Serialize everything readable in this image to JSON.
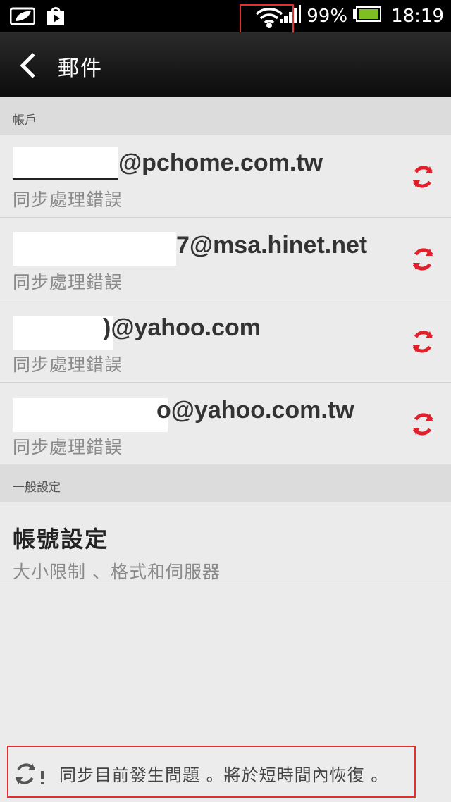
{
  "status_bar": {
    "battery_percent": "99%",
    "time": "18:19"
  },
  "action_bar": {
    "title": "郵件"
  },
  "sections": {
    "accounts_header": "帳戶",
    "general_header": "一般設定"
  },
  "accounts": [
    {
      "email_suffix": "@pchome.com.tw",
      "status": "同步處理錯誤"
    },
    {
      "email_suffix": "7@msa.hinet.net",
      "status": "同步處理錯誤"
    },
    {
      "email_suffix": ")@yahoo.com",
      "status": "同步處理錯誤"
    },
    {
      "email_suffix": "o@yahoo.com.tw",
      "status": "同步處理錯誤"
    }
  ],
  "settings": {
    "title": "帳號設定",
    "subtitle": "大小限制 、格式和伺服器"
  },
  "notice": {
    "text": "同步目前發生問題 。將於短時間內恢復 。"
  },
  "colors": {
    "accent_red": "#e0202b",
    "battery_green": "#7ec022"
  },
  "icons": [
    "leaf-icon",
    "play-store-icon",
    "wifi-icon",
    "signal-icon",
    "battery-icon",
    "back-icon",
    "sync-icon",
    "sync-warning-icon"
  ]
}
